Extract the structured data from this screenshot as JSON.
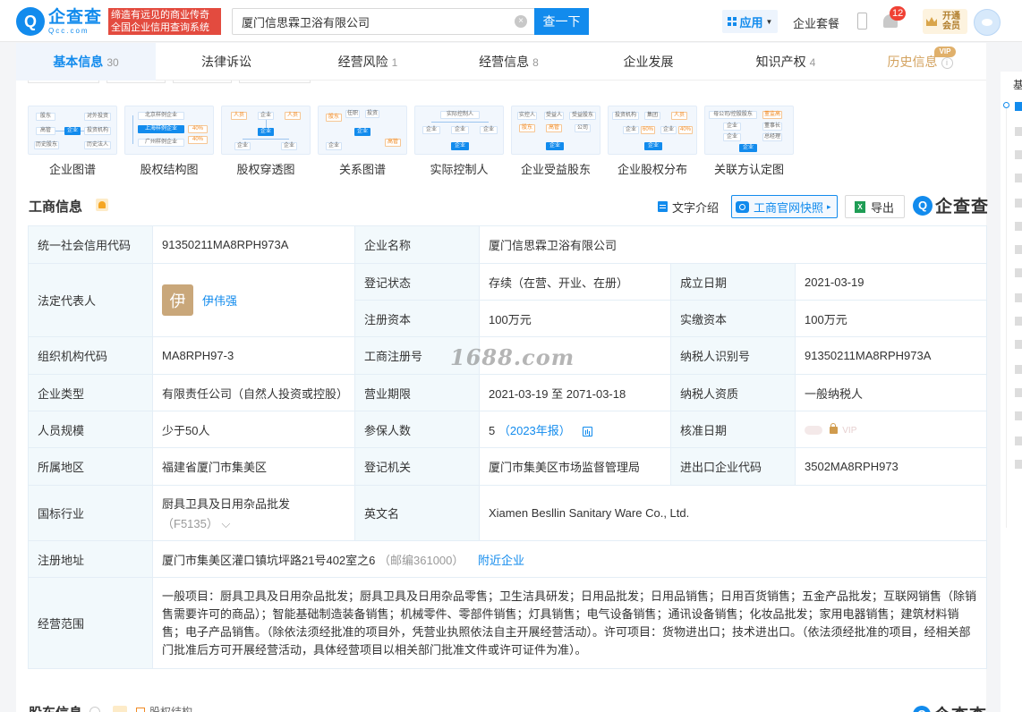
{
  "header": {
    "logo_cn": "企查查",
    "logo_en": "Qcc.com",
    "slogan_line1": "缔造有远见的商业传奇",
    "slogan_line2": "全国企业信用查询系统",
    "search_value": "厦门信思霖卫浴有限公司",
    "search_clear_glyph": "×",
    "search_button": "查一下",
    "apps_label": "应用",
    "suite_label": "企业套餐",
    "notification_count": "12",
    "vip_line1": "开通",
    "vip_line2": "会员"
  },
  "tabs": [
    {
      "label": "基本信息",
      "count": "30"
    },
    {
      "label": "法律诉讼",
      "count": ""
    },
    {
      "label": "经营风险",
      "count": "1"
    },
    {
      "label": "经营信息",
      "count": "8"
    },
    {
      "label": "企业发展",
      "count": ""
    },
    {
      "label": "知识产权",
      "count": "4"
    },
    {
      "label": "历史信息",
      "count": ""
    }
  ],
  "vip_tag": "VIP",
  "info_glyph": "i",
  "graphs": [
    {
      "label": "企业图谱",
      "icon": "enterprise-graph-icon",
      "nodes": [
        "股东",
        "对外投资",
        "高管",
        "企业",
        "投资机构",
        "历史股东",
        "历史法人"
      ]
    },
    {
      "label": "股权结构图",
      "icon": "equity-structure-icon",
      "nodes": [
        "北京样例企业",
        "上海样例企业",
        "广州样例企业",
        "40%",
        "40%",
        "20%"
      ]
    },
    {
      "label": "股权穿透图",
      "icon": "equity-penetration-icon",
      "nodes": [
        "人员",
        "企业",
        "人员",
        "企业",
        "企业",
        "企业"
      ]
    },
    {
      "label": "关系图谱",
      "icon": "relation-graph-icon",
      "nodes": [
        "股东",
        "任职",
        "投资",
        "企业",
        "高管",
        "企业"
      ]
    },
    {
      "label": "实际控制人",
      "icon": "actual-controller-icon",
      "nodes": [
        "实际控制人",
        "企业",
        "企业",
        "企业",
        "企业"
      ]
    },
    {
      "label": "企业受益股东",
      "icon": "beneficiary-icon",
      "nodes": [
        "实控人",
        "受益人",
        "受益股东",
        "股东",
        "高管",
        "公司",
        "企业"
      ]
    },
    {
      "label": "企业股权分布",
      "icon": "equity-distribution-icon",
      "nodes": [
        "投资机构",
        "集团",
        "人员",
        "企业",
        "60%",
        "企业",
        "40%",
        "企业"
      ]
    },
    {
      "label": "关联方认定图",
      "icon": "related-party-icon",
      "nodes": [
        "母公司/控股股东",
        "董监高",
        "企业",
        "董事长",
        "企业",
        "总经理",
        "企业"
      ]
    }
  ],
  "section": {
    "title": "工商信息",
    "text_intro": "文字介绍",
    "snapshot": "工商官网快照",
    "export": "导出",
    "export_icon_glyph": "X",
    "brand": "企查查"
  },
  "watermark": "1688.com",
  "legal_avatar_char": "伊",
  "chevron": "⌵",
  "info": {
    "credit_code_k": "统一社会信用代码",
    "credit_code_v": "91350211MA8RPH973A",
    "name_k": "企业名称",
    "name_v": "厦门信思霖卫浴有限公司",
    "legal_k": "法定代表人",
    "legal_v": "伊伟强",
    "status_k": "登记状态",
    "status_v": "存续（在营、开业、在册）",
    "founded_k": "成立日期",
    "founded_v": "2021-03-19",
    "reg_capital_k": "注册资本",
    "reg_capital_v": "100万元",
    "paid_capital_k": "实缴资本",
    "paid_capital_v": "100万元",
    "org_code_k": "组织机构代码",
    "org_code_v": "MA8RPH97-3",
    "reg_no_k": "工商注册号",
    "reg_no_v": "",
    "taxpayer_id_k": "纳税人识别号",
    "taxpayer_id_v": "91350211MA8RPH973A",
    "type_k": "企业类型",
    "type_v": "有限责任公司（自然人投资或控股）",
    "term_k": "营业期限",
    "term_v": "2021-03-19 至 2071-03-18",
    "tax_qual_k": "纳税人资质",
    "tax_qual_v": "一般纳税人",
    "staff_k": "人员规模",
    "staff_v": "少于50人",
    "insured_k": "参保人数",
    "insured_v": "5",
    "insured_year": "（2023年报）",
    "approved_k": "核准日期",
    "approved_vip": "VIP",
    "region_k": "所属地区",
    "region_v": "福建省厦门市集美区",
    "authority_k": "登记机关",
    "authority_v": "厦门市集美区市场监督管理局",
    "import_export_k": "进出口企业代码",
    "import_export_v": "3502MA8RPH973",
    "industry_k": "国标行业",
    "industry_v": "厨具卫具及日用杂品批发",
    "industry_code": "（F5135）",
    "en_name_k": "英文名",
    "en_name_v": "Xiamen Besllin Sanitary Ware Co., Ltd.",
    "address_k": "注册地址",
    "address_v": "厦门市集美区灌口镇坑坪路21号402室之6",
    "postcode": "（邮编361000）",
    "nearby": "附近企业",
    "scope_k": "经营范围",
    "scope_v": "一般项目：厨具卫具及日用杂品批发；厨具卫具及日用杂品零售；卫生洁具研发；日用品批发；日用品销售；日用百货销售；五金产品批发；互联网销售（除销售需要许可的商品）；智能基础制造装备销售；机械零件、零部件销售；灯具销售；电气设备销售；通讯设备销售；化妆品批发；家用电器销售；建筑材料销售；电子产品销售。（除依法须经批准的项目外，凭营业执照依法自主开展经营活动）。许可项目：货物进出口；技术进出口。（依法须经批准的项目，经相关部门批准后方可开展经营活动，具体经营项目以相关部门批准文件或许可证件为准）。"
  },
  "next_section": {
    "title": "股东信息",
    "tool": "股权结构"
  },
  "right_nav": {
    "title": "基"
  }
}
